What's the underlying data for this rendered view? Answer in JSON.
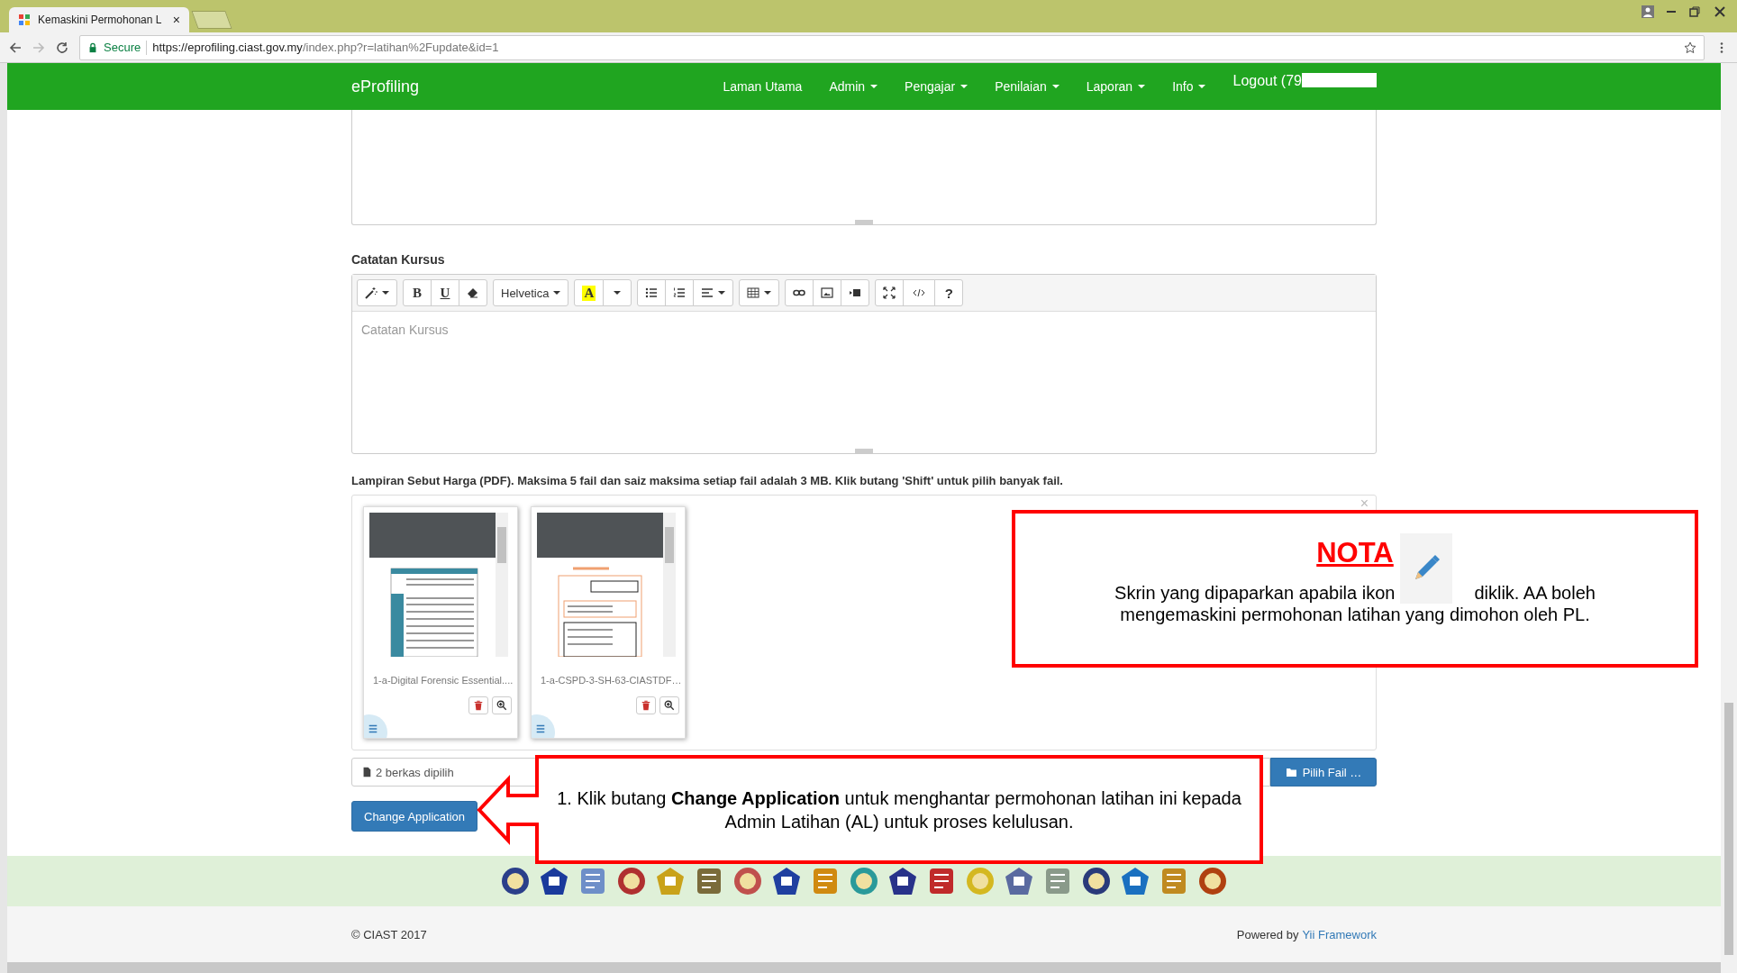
{
  "browser": {
    "tab_title": "Kemaskini Permohonan L",
    "tab_close": "×",
    "secure": "Secure",
    "url_host": "https://eprofiling.ciast.gov.my",
    "url_path": "/index.php?r=latihan%2Fupdate&id=1"
  },
  "navbar": {
    "brand": "eProfiling",
    "items": [
      {
        "label": "Laman Utama",
        "dropdown": false
      },
      {
        "label": "Admin",
        "dropdown": true
      },
      {
        "label": "Pengajar",
        "dropdown": true
      },
      {
        "label": "Penilaian",
        "dropdown": true
      },
      {
        "label": "Laporan",
        "dropdown": true
      },
      {
        "label": "Info",
        "dropdown": true
      }
    ],
    "logout": "Logout (79"
  },
  "editor": {
    "label": "Catatan Kursus",
    "placeholder": "Catatan Kursus",
    "groups": [
      {
        "buttons": [
          {
            "kind": "magic",
            "caret": true
          }
        ]
      },
      {
        "buttons": [
          {
            "kind": "bold",
            "label": "B",
            "caret": false
          },
          {
            "kind": "underline",
            "label": "U",
            "caret": false
          },
          {
            "kind": "eraser",
            "caret": false
          }
        ]
      },
      {
        "buttons": [
          {
            "kind": "font",
            "label": "Helvetica",
            "caret": true
          }
        ]
      },
      {
        "buttons": [
          {
            "kind": "color",
            "label": "A",
            "caret": false
          },
          {
            "kind": "more",
            "caret": true
          }
        ]
      },
      {
        "buttons": [
          {
            "kind": "ul",
            "caret": false
          },
          {
            "kind": "ol",
            "caret": false
          },
          {
            "kind": "align",
            "caret": true
          }
        ]
      },
      {
        "buttons": [
          {
            "kind": "table",
            "caret": true
          }
        ]
      },
      {
        "buttons": [
          {
            "kind": "link",
            "caret": false
          },
          {
            "kind": "picture",
            "caret": false
          },
          {
            "kind": "video",
            "caret": false
          }
        ]
      },
      {
        "buttons": [
          {
            "kind": "fullscreen",
            "caret": false
          },
          {
            "kind": "code",
            "caret": false
          },
          {
            "kind": "help",
            "label": "?",
            "caret": false
          }
        ]
      }
    ]
  },
  "attachments": {
    "label": "Lampiran Sebut Harga (PDF). Maksima 5 fail dan saiz maksima setiap fail adalah 3 MB. Klik butang 'Shift' untuk pilih banyak fail.",
    "close": "×",
    "files": [
      {
        "name": "1-a-Digital Forensic Essential....",
        "kind": "table-doc"
      },
      {
        "name": "1-a-CSPD-3-SH-63-CIASTDF…",
        "kind": "quote-doc"
      }
    ],
    "caption": "2 berkas dipilih",
    "browse": "Pilih Fail …"
  },
  "submit": "Change Application",
  "note": {
    "title": "NOTA",
    "text_before": "Skrin yang dipaparkan apabila ikon",
    "text_after": "diklik. AA boleh",
    "text_line2": "mengemaskini permohonan latihan yang dimohon oleh PL."
  },
  "instruction": {
    "text": "1. Klik butang **Change Application** untuk menghantar permohonan latihan ini kepada Admin Latihan (AL) untuk proses kelulusan."
  },
  "footer": {
    "copyright": "© CIAST 2017",
    "powered_by": "Powered by",
    "link": "Yii Framework"
  }
}
